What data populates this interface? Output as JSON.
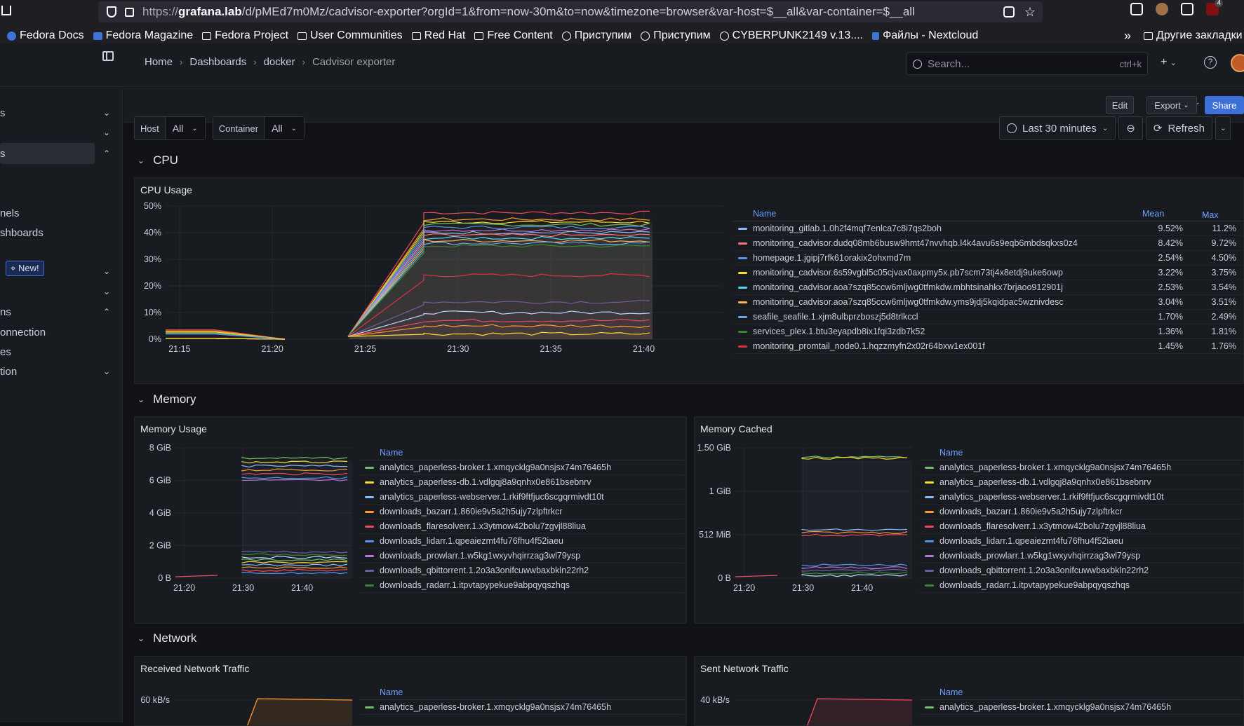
{
  "browser": {
    "url_prefix": "https://",
    "url_host": "grafana.lab",
    "url_rest": "/d/pMEd7m0Mz/cadvisor-exporter?orgId=1&from=now-30m&to=now&timezone=browser&var-host=$__all&var-container=$__all",
    "bookmarks": [
      "Fedora Docs",
      "Fedora Magazine",
      "Fedora Project",
      "User Communities",
      "Red Hat",
      "Free Content",
      "Приступим",
      "Приступим",
      "CYBERPUNK2149 v.13....",
      "Файлы - Nextcloud"
    ],
    "other_bookmarks": "Другие закладки",
    "overflow": "»",
    "badge": "4"
  },
  "sidebar": {
    "items": [
      {
        "label": "s",
        "chevron": "⌄"
      },
      {
        "label": "",
        "chevron": "⌄"
      },
      {
        "label": "s",
        "chevron": "⌃"
      },
      {
        "label": "nels",
        "chevron": ""
      },
      {
        "label": "shboards",
        "chevron": ""
      },
      {
        "label": "New!",
        "chevron": "⌄"
      },
      {
        "label": "",
        "chevron": "⌄"
      },
      {
        "label": "ns",
        "chevron": "⌃"
      },
      {
        "label": "onnection",
        "chevron": ""
      },
      {
        "label": "es",
        "chevron": ""
      },
      {
        "label": "tion",
        "chevron": "⌄"
      }
    ]
  },
  "topnav": {
    "breadcrumb": [
      "Home",
      "Dashboards",
      "docker",
      "Cadvisor exporter"
    ],
    "search_placeholder": "Search...",
    "search_shortcut": "ctrl+k",
    "plus": "+",
    "help": "?"
  },
  "actions": {
    "edit": "Edit",
    "export": "Export",
    "share": "Share"
  },
  "variables": [
    {
      "label": "Host",
      "value": "All"
    },
    {
      "label": "Container",
      "value": "All"
    }
  ],
  "timepicker": {
    "range": "Last 30 minutes",
    "refresh": "Refresh"
  },
  "rows": {
    "cpu": "CPU",
    "memory": "Memory",
    "network": "Network"
  },
  "colors": {
    "accent": "#3d71d9",
    "bg": "#111217",
    "panel": "#181b1f"
  },
  "cpu_panel": {
    "title": "CPU Usage",
    "legend_headers": {
      "name": "Name",
      "mean": "Mean",
      "max": "Max"
    },
    "legend": [
      {
        "name": "monitoring_gitlab.1.0h2f4mqf7enlca7c8i7qs2boh",
        "mean": "9.52%",
        "max": "11.2%",
        "color": "#8ab8ff"
      },
      {
        "name": "monitoring_cadvisor.dudq08mb6busw9hmt47nvvhqb.l4k4avu6s9eqb6mbdsqkxs0z4",
        "mean": "8.42%",
        "max": "9.72%",
        "color": "#ff7383"
      },
      {
        "name": "homepage.1.jgipj7rfk61orakix2ohxmd7m",
        "mean": "2.54%",
        "max": "4.50%",
        "color": "#5794f2"
      },
      {
        "name": "monitoring_cadvisor.6s59vgbl5c05cjvax0axpmy5x.pb7scm73tj4x8etdj9uke6owp",
        "mean": "3.22%",
        "max": "3.75%",
        "color": "#fade2a"
      },
      {
        "name": "monitoring_cadvisor.aoa7szq85ccw6mljwg0tfmkdw.mbhtsinahkx7brjaoo912901j",
        "mean": "2.53%",
        "max": "3.54%",
        "color": "#5ad7f0"
      },
      {
        "name": "monitoring_cadvisor.aoa7szq85ccw6mljwg0tfmkdw.yms9jdj5kqidpac5wznivdesc",
        "mean": "3.04%",
        "max": "3.51%",
        "color": "#ffb357"
      },
      {
        "name": "seafile_seafile.1.xjm8ulbprzboszj5d8trlkccl",
        "mean": "1.70%",
        "max": "2.49%",
        "color": "#6aa6e8"
      },
      {
        "name": "services_plex.1.btu3eyapdb8ix1fqi3zdb7k52",
        "mean": "1.36%",
        "max": "1.81%",
        "color": "#37872d"
      },
      {
        "name": "monitoring_promtail_node0.1.hqzzmyfn2x02r64bxw1ex001f",
        "mean": "1.45%",
        "max": "1.76%",
        "color": "#e02f44"
      }
    ]
  },
  "memory_panel": {
    "title": "Memory Usage",
    "legend_header": "Name",
    "legend": [
      {
        "name": "analytics_paperless-broker.1.xmqycklg9a0nsjsx74m76465h",
        "color": "#73bf69"
      },
      {
        "name": "analytics_paperless-db.1.vdlgqj8a9qnhx0e861bsebnrv",
        "color": "#fade2a"
      },
      {
        "name": "analytics_paperless-webserver.1.rkif9ftfjuc6scgqrmivdt10t",
        "color": "#8ab8ff"
      },
      {
        "name": "downloads_bazarr.1.860ie9v5a2h5ujy7zlpftrkcr",
        "color": "#ff9830"
      },
      {
        "name": "downloads_flaresolverr.1.x3ytmow42bolu7zgvjl88liua",
        "color": "#f2495c"
      },
      {
        "name": "downloads_lidarr.1.qpeaiezmt4fu76fhu4f52iaeu",
        "color": "#5794f2"
      },
      {
        "name": "downloads_prowlarr.1.w5kg1wxyvhqirrzag3wl79ysp",
        "color": "#b877d9"
      },
      {
        "name": "downloads_qbittorrent.1.2o3a3onifcuwwbaxbkln22rh2",
        "color": "#705da0"
      },
      {
        "name": "downloads_radarr.1.itpvtapypekue9abpqyqszhqs",
        "color": "#37872d"
      }
    ]
  },
  "cached_panel": {
    "title": "Memory Cached",
    "legend_header": "Name",
    "legend": [
      {
        "name": "analytics_paperless-broker.1.xmqycklg9a0nsjsx74m76465h",
        "color": "#73bf69"
      },
      {
        "name": "analytics_paperless-db.1.vdlgqj8a9qnhx0e861bsebnrv",
        "color": "#fade2a"
      },
      {
        "name": "analytics_paperless-webserver.1.rkif9ftfjuc6scgqrmivdt10t",
        "color": "#8ab8ff"
      },
      {
        "name": "downloads_bazarr.1.860ie9v5a2h5ujy7zlpftrkcr",
        "color": "#ff9830"
      },
      {
        "name": "downloads_flaresolverr.1.x3ytmow42bolu7zgvjl88liua",
        "color": "#f2495c"
      },
      {
        "name": "downloads_lidarr.1.qpeaiezmt4fu76fhu4f52iaeu",
        "color": "#5794f2"
      },
      {
        "name": "downloads_prowlarr.1.w5kg1wxyvhqirrzag3wl79ysp",
        "color": "#b877d9"
      },
      {
        "name": "downloads_qbittorrent.1.2o3a3onifcuwwbaxbkln22rh2",
        "color": "#705da0"
      },
      {
        "name": "downloads_radarr.1.itpvtapypekue9abpqyqszhqs",
        "color": "#37872d"
      }
    ]
  },
  "recv_panel": {
    "title": "Received Network Traffic",
    "legend_header": "Name",
    "legend": [
      {
        "name": "analytics_paperless-broker.1.xmqycklg9a0nsjsx74m76465h",
        "color": "#73bf69"
      }
    ]
  },
  "sent_panel": {
    "title": "Sent Network Traffic",
    "legend_header": "Name",
    "legend": [
      {
        "name": "analytics_paperless-broker.1.xmqycklg9a0nsjsx74m76465h",
        "color": "#73bf69"
      }
    ]
  },
  "chart_data": [
    {
      "type": "line",
      "title": "CPU Usage",
      "x_ticks": [
        "21:15",
        "21:20",
        "21:25",
        "21:30",
        "21:35",
        "21:40"
      ],
      "y_ticks": [
        "0%",
        "10%",
        "20%",
        "30%",
        "40%",
        "50%"
      ],
      "ylim": [
        0,
        50
      ]
    },
    {
      "type": "line",
      "title": "Memory Usage",
      "x_ticks": [
        "21:20",
        "21:30",
        "21:40"
      ],
      "y_ticks": [
        "0 B",
        "2 GiB",
        "4 GiB",
        "6 GiB",
        "8 GiB"
      ]
    },
    {
      "type": "line",
      "title": "Memory Cached",
      "x_ticks": [
        "21:20",
        "21:30",
        "21:40"
      ],
      "y_ticks": [
        "0 B",
        "512 MiB",
        "1 GiB",
        "1.50 GiB"
      ]
    },
    {
      "type": "line",
      "title": "Received Network Traffic",
      "y_ticks": [
        "60 kB/s"
      ]
    },
    {
      "type": "line",
      "title": "Sent Network Traffic",
      "y_ticks": [
        "40 kB/s"
      ]
    }
  ]
}
